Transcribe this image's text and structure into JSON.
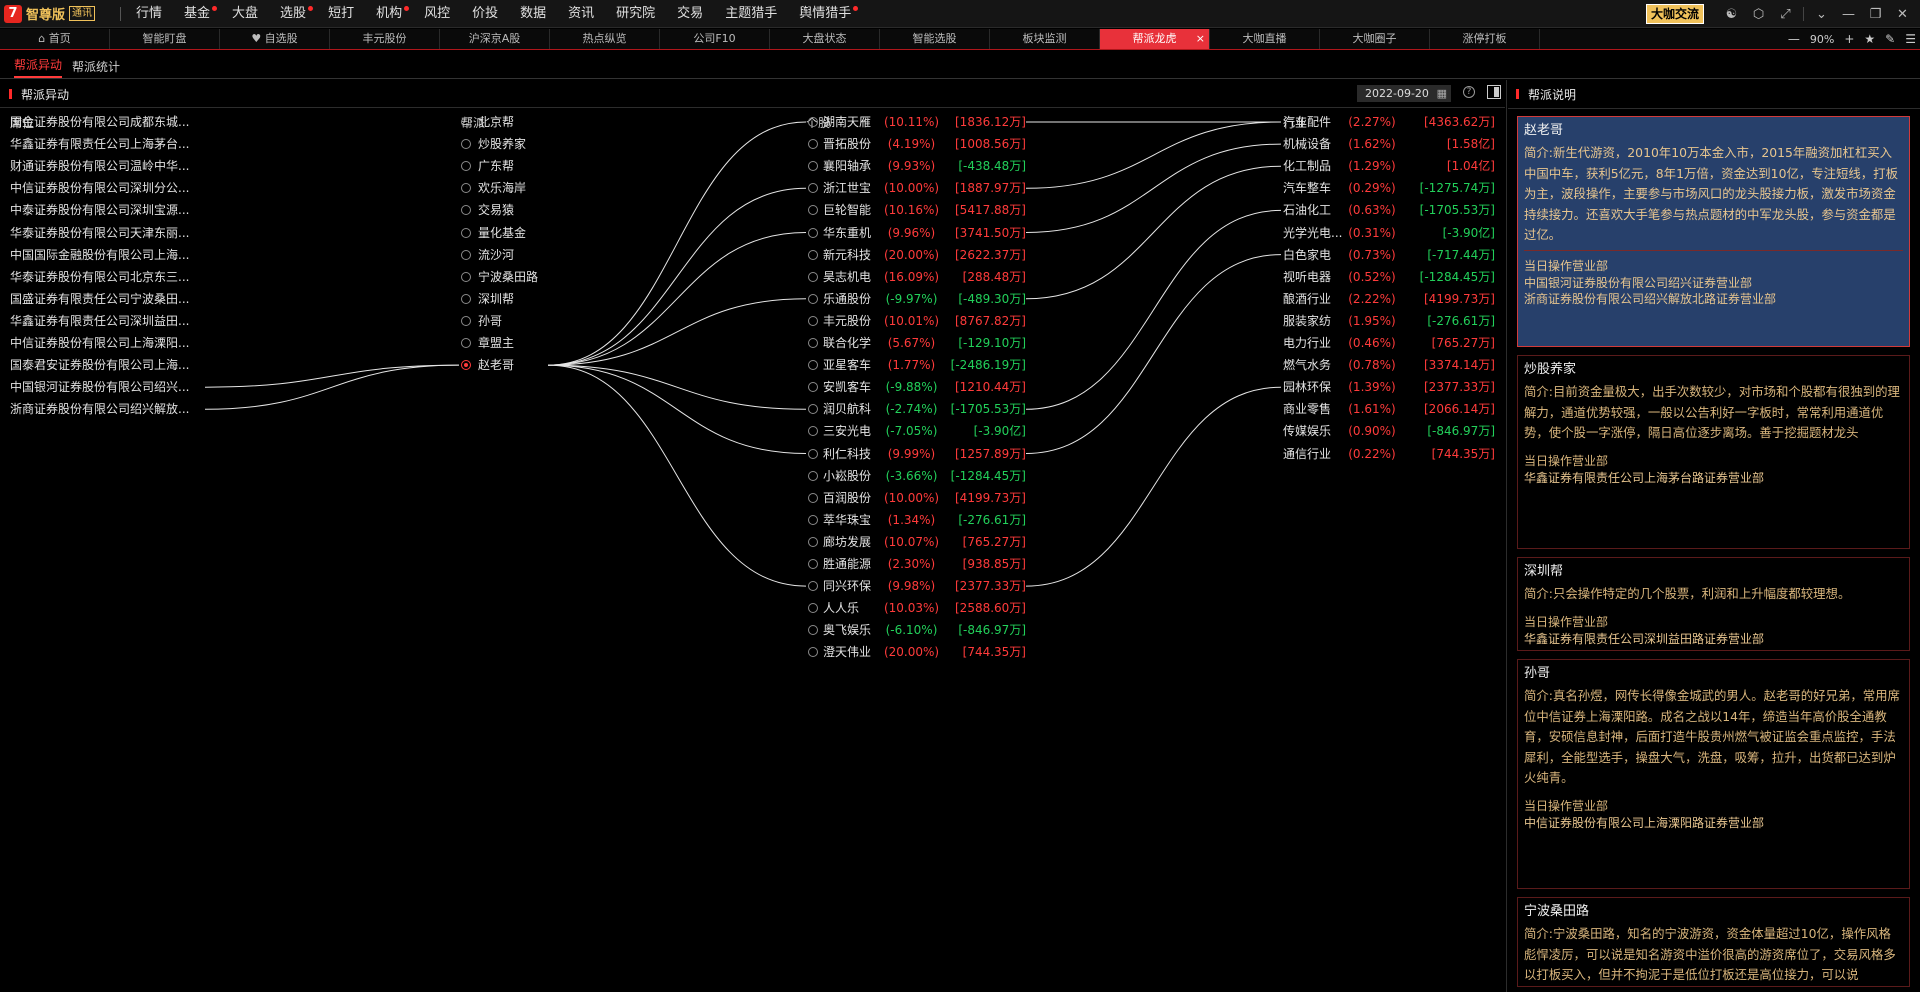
{
  "app": {
    "logo_mark": "7",
    "logo_text": "智尊版",
    "logo_badge": "通讯",
    "cta": "大咖交流"
  },
  "menu": [
    {
      "label": "行情",
      "dot": false
    },
    {
      "label": "基金",
      "dot": true
    },
    {
      "label": "大盘",
      "dot": false
    },
    {
      "label": "选股",
      "dot": true
    },
    {
      "label": "短打",
      "dot": false
    },
    {
      "label": "机构",
      "dot": true
    },
    {
      "label": "风控",
      "dot": false
    },
    {
      "label": "价投",
      "dot": false
    },
    {
      "label": "数据",
      "dot": false
    },
    {
      "label": "资讯",
      "dot": false
    },
    {
      "label": "研究院",
      "dot": false
    },
    {
      "label": "交易",
      "dot": false
    },
    {
      "label": "主题猎手",
      "dot": false
    },
    {
      "label": "舆情猎手",
      "dot": true
    }
  ],
  "tabs": [
    {
      "label": "⌂ 首页"
    },
    {
      "label": "智能盯盘"
    },
    {
      "label": "♥ 自选股"
    },
    {
      "label": "丰元股份"
    },
    {
      "label": "沪深京A股"
    },
    {
      "label": "热点纵览"
    },
    {
      "label": "公司F10"
    },
    {
      "label": "大盘状态"
    },
    {
      "label": "智能选股"
    },
    {
      "label": "板块监测"
    },
    {
      "label": "帮派龙虎",
      "active": true
    },
    {
      "label": "大咖直播"
    },
    {
      "label": "大咖圈子"
    },
    {
      "label": "涨停打板"
    }
  ],
  "zoom": "90%",
  "subtabs": [
    {
      "label": "帮派异动",
      "active": true
    },
    {
      "label": "帮派统计",
      "active": false
    }
  ],
  "left_panel": {
    "title": "帮派异动",
    "date": "2022-09-20",
    "headers": {
      "seat": "席位",
      "faction": "帮派",
      "stock": "个股",
      "industry": "行业"
    }
  },
  "seats": [
    "国金证券股份有限公司成都东城...",
    "华鑫证券有限责任公司上海茅台...",
    "财通证券股份有限公司温岭中华...",
    "中信证券股份有限公司深圳分公...",
    "中泰证券股份有限公司深圳宝源...",
    "华泰证券股份有限公司天津东丽...",
    "中国国际金融股份有限公司上海...",
    "华泰证券股份有限公司北京东三...",
    "国盛证券有限责任公司宁波桑田...",
    "华鑫证券有限责任公司深圳益田...",
    "中信证券股份有限公司上海溧阳...",
    "国泰君安证券股份有限公司上海...",
    "中国银河证券股份有限公司绍兴...",
    "浙商证券股份有限公司绍兴解放..."
  ],
  "factions": [
    {
      "name": "北京帮",
      "selected": false
    },
    {
      "name": "炒股养家",
      "selected": false
    },
    {
      "name": "广东帮",
      "selected": false
    },
    {
      "name": "欢乐海岸",
      "selected": false
    },
    {
      "name": "交易猿",
      "selected": false
    },
    {
      "name": "量化基金",
      "selected": false
    },
    {
      "name": "流沙河",
      "selected": false
    },
    {
      "name": "宁波桑田路",
      "selected": false
    },
    {
      "name": "深圳帮",
      "selected": false
    },
    {
      "name": "孙哥",
      "selected": false
    },
    {
      "name": "章盟主",
      "selected": false
    },
    {
      "name": "赵老哥",
      "selected": true
    }
  ],
  "stocks": [
    {
      "name": "湖南天雁",
      "pct": "(10.11%)",
      "amt": "[1836.12万]",
      "pct_up": true,
      "amt_up": true
    },
    {
      "name": "晋拓股份",
      "pct": "(4.19%)",
      "amt": "[1008.56万]",
      "pct_up": true,
      "amt_up": true
    },
    {
      "name": "襄阳轴承",
      "pct": "(9.93%)",
      "amt": "[-438.48万]",
      "pct_up": true,
      "amt_up": false
    },
    {
      "name": "浙江世宝",
      "pct": "(10.00%)",
      "amt": "[1887.97万]",
      "pct_up": true,
      "amt_up": true
    },
    {
      "name": "巨轮智能",
      "pct": "(10.16%)",
      "amt": "[5417.88万]",
      "pct_up": true,
      "amt_up": true
    },
    {
      "name": "华东重机",
      "pct": "(9.96%)",
      "amt": "[3741.50万]",
      "pct_up": true,
      "amt_up": true
    },
    {
      "name": "新元科技",
      "pct": "(20.00%)",
      "amt": "[2622.37万]",
      "pct_up": true,
      "amt_up": true
    },
    {
      "name": "昊志机电",
      "pct": "(16.09%)",
      "amt": "[288.48万]",
      "pct_up": true,
      "amt_up": true
    },
    {
      "name": "乐通股份",
      "pct": "(-9.97%)",
      "amt": "[-489.30万]",
      "pct_up": false,
      "amt_up": false
    },
    {
      "name": "丰元股份",
      "pct": "(10.01%)",
      "amt": "[8767.82万]",
      "pct_up": true,
      "amt_up": true
    },
    {
      "name": "联合化学",
      "pct": "(5.67%)",
      "amt": "[-129.10万]",
      "pct_up": true,
      "amt_up": false
    },
    {
      "name": "亚星客车",
      "pct": "(1.77%)",
      "amt": "[-2486.19万]",
      "pct_up": true,
      "amt_up": false
    },
    {
      "name": "安凯客车",
      "pct": "(-9.88%)",
      "amt": "[1210.44万]",
      "pct_up": false,
      "amt_up": true
    },
    {
      "name": "润贝航科",
      "pct": "(-2.74%)",
      "amt": "[-1705.53万]",
      "pct_up": false,
      "amt_up": false
    },
    {
      "name": "三安光电",
      "pct": "(-7.05%)",
      "amt": "[-3.90亿]",
      "pct_up": false,
      "amt_up": false
    },
    {
      "name": "利仁科技",
      "pct": "(9.99%)",
      "amt": "[1257.89万]",
      "pct_up": true,
      "amt_up": true
    },
    {
      "name": "小崧股份",
      "pct": "(-3.66%)",
      "amt": "[-1284.45万]",
      "pct_up": false,
      "amt_up": false
    },
    {
      "name": "百润股份",
      "pct": "(10.00%)",
      "amt": "[4199.73万]",
      "pct_up": true,
      "amt_up": true
    },
    {
      "name": "萃华珠宝",
      "pct": "(1.34%)",
      "amt": "[-276.61万]",
      "pct_up": true,
      "amt_up": false
    },
    {
      "name": "廊坊发展",
      "pct": "(10.07%)",
      "amt": "[765.27万]",
      "pct_up": true,
      "amt_up": true
    },
    {
      "name": "胜通能源",
      "pct": "(2.30%)",
      "amt": "[938.85万]",
      "pct_up": true,
      "amt_up": true
    },
    {
      "name": "同兴环保",
      "pct": "(9.98%)",
      "amt": "[2377.33万]",
      "pct_up": true,
      "amt_up": true
    },
    {
      "name": "人人乐",
      "pct": "(10.03%)",
      "amt": "[2588.60万]",
      "pct_up": true,
      "amt_up": true
    },
    {
      "name": "奥飞娱乐",
      "pct": "(-6.10%)",
      "amt": "[-846.97万]",
      "pct_up": false,
      "amt_up": false
    },
    {
      "name": "澄天伟业",
      "pct": "(20.00%)",
      "amt": "[744.35万]",
      "pct_up": true,
      "amt_up": true
    }
  ],
  "industries": [
    {
      "name": "汽车配件",
      "pct": "(2.27%)",
      "amt": "[4363.62万]",
      "pct_up": true,
      "amt_up": true
    },
    {
      "name": "机械设备",
      "pct": "(1.62%)",
      "amt": "[1.58亿]",
      "pct_up": true,
      "amt_up": true
    },
    {
      "name": "化工制品",
      "pct": "(1.29%)",
      "amt": "[1.04亿]",
      "pct_up": true,
      "amt_up": true
    },
    {
      "name": "汽车整车",
      "pct": "(0.29%)",
      "amt": "[-1275.74万]",
      "pct_up": true,
      "amt_up": false
    },
    {
      "name": "石油化工",
      "pct": "(0.63%)",
      "amt": "[-1705.53万]",
      "pct_up": true,
      "amt_up": false
    },
    {
      "name": "光学光电...",
      "pct": "(0.31%)",
      "amt": "[-3.90亿]",
      "pct_up": true,
      "amt_up": false
    },
    {
      "name": "白色家电",
      "pct": "(0.73%)",
      "amt": "[-717.44万]",
      "pct_up": true,
      "amt_up": false
    },
    {
      "name": "视听电器",
      "pct": "(0.52%)",
      "amt": "[-1284.45万]",
      "pct_up": true,
      "amt_up": false
    },
    {
      "name": "酿酒行业",
      "pct": "(2.22%)",
      "amt": "[4199.73万]",
      "pct_up": true,
      "amt_up": true
    },
    {
      "name": "服装家纺",
      "pct": "(1.95%)",
      "amt": "[-276.61万]",
      "pct_up": true,
      "amt_up": false
    },
    {
      "name": "电力行业",
      "pct": "(0.46%)",
      "amt": "[765.27万]",
      "pct_up": true,
      "amt_up": true
    },
    {
      "name": "燃气水务",
      "pct": "(0.78%)",
      "amt": "[3374.14万]",
      "pct_up": true,
      "amt_up": true
    },
    {
      "name": "园林环保",
      "pct": "(1.39%)",
      "amt": "[2377.33万]",
      "pct_up": true,
      "amt_up": true
    },
    {
      "name": "商业零售",
      "pct": "(1.61%)",
      "amt": "[2066.14万]",
      "pct_up": true,
      "amt_up": true
    },
    {
      "name": "传媒娱乐",
      "pct": "(0.90%)",
      "amt": "[-846.97万]",
      "pct_up": true,
      "amt_up": false
    },
    {
      "name": "通信行业",
      "pct": "(0.22%)",
      "amt": "[744.35万]",
      "pct_up": true,
      "amt_up": true
    }
  ],
  "links": {
    "seat_to_faction": [
      [
        12,
        11
      ],
      [
        13,
        11
      ]
    ],
    "faction_to_stock": [
      11,
      [
        0,
        3,
        5,
        8,
        13,
        15,
        21
      ]
    ],
    "stock_to_industry": [
      [
        0,
        0
      ],
      [
        3,
        0
      ],
      [
        5,
        1
      ],
      [
        8,
        2
      ],
      [
        13,
        4
      ],
      [
        15,
        6
      ],
      [
        21,
        12
      ]
    ]
  },
  "right_panel": {
    "title": "帮派说明",
    "op_label": "当日操作营业部",
    "cards": [
      {
        "name": "赵老哥",
        "highlight": true,
        "desc": "简介:新生代游资，2010年10万本金入市，2015年融资加杠杠买入中国中车，获利5亿元，8年1万倍，资金达到10亿，专注短线，打板为主，波段操作，主要参与市场风口的龙头股接力板，激发市场资金持续接力。还喜欢大手笔参与热点题材的中军龙头股，参与资金都是过亿。",
        "seats": [
          "中国银河证券股份有限公司绍兴证券营业部",
          "浙商证券股份有限公司绍兴解放北路证券营业部"
        ]
      },
      {
        "name": "炒股养家",
        "highlight": false,
        "desc": "简介:目前资金量极大，出手次数较少，对市场和个股都有很独到的理解力，通道优势较强，一般以公告利好一字板时，常常利用通道优势，使个股一字涨停，隔日高位逐步离场。善于挖掘题材龙头",
        "seats": [
          "华鑫证券有限责任公司上海茅台路证券营业部"
        ]
      },
      {
        "name": "深圳帮",
        "highlight": false,
        "desc": "简介:只会操作特定的几个股票，利润和上升幅度都较理想。",
        "seats": [
          "华鑫证券有限责任公司深圳益田路证券营业部"
        ]
      },
      {
        "name": "孙哥",
        "highlight": false,
        "desc": "简介:真名孙煜，网传长得像金城武的男人。赵老哥的好兄弟，常用席位中信证券上海溧阳路。成名之战以14年，缔造当年高价股全通教育，安硕信息封神，后面打造牛股贵州燃气被证监会重点监控，手法犀利，全能型选手，操盘大气，洗盘，吸筹，拉升，出货都已达到炉火纯青。",
        "seats": [
          "中信证券股份有限公司上海溧阳路证券营业部"
        ]
      },
      {
        "name": "宁波桑田路",
        "highlight": false,
        "desc": "简介:宁波桑田路，知名的宁波游资，资金体量超过10亿，操作风格彪悍凌厉，可以说是知名游资中溢价很高的游资席位了，交易风格多以打板买入，但并不拘泥于是低位打板还是高位接力，可以说",
        "seats": []
      }
    ]
  }
}
